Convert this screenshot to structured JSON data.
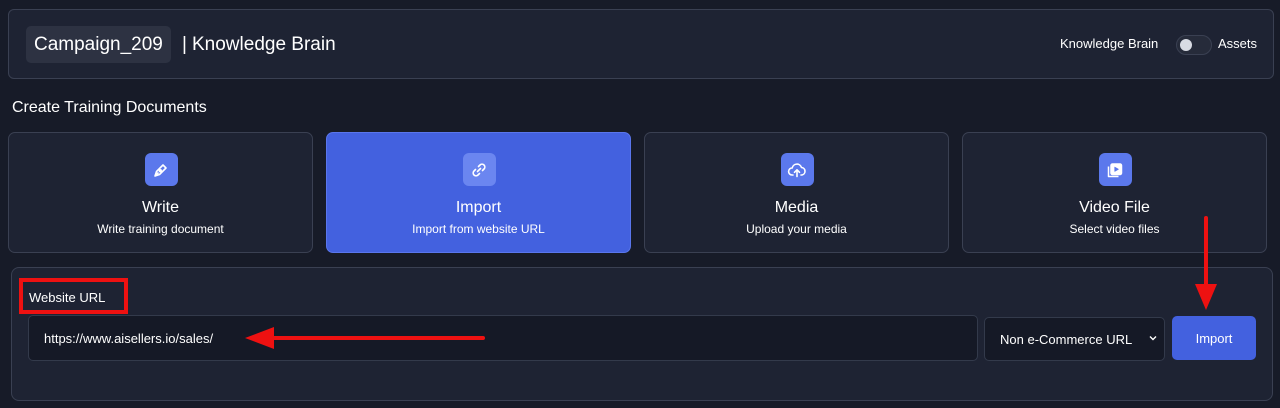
{
  "header": {
    "campaign": "Campaign_209",
    "separator": "|",
    "title": "Knowledge Brain",
    "toggle_left_label": "Knowledge Brain",
    "toggle_right_label": "Assets",
    "toggle_on": false
  },
  "section_title": "Create Training Documents",
  "cards": [
    {
      "title": "Write",
      "subtitle": "Write training document",
      "icon": "pen-icon",
      "active": false
    },
    {
      "title": "Import",
      "subtitle": "Import from website URL",
      "icon": "link-icon",
      "active": true
    },
    {
      "title": "Media",
      "subtitle": "Upload your media",
      "icon": "cloud-upload-icon",
      "active": false
    },
    {
      "title": "Video File",
      "subtitle": "Select video files",
      "icon": "video-file-icon",
      "active": false
    }
  ],
  "url_form": {
    "label": "Website URL",
    "value": "https://www.aisellers.io/sales/",
    "select_value": "Non e-Commerce URL",
    "import_label": "Import"
  },
  "colors": {
    "background": "#171b28",
    "panel": "#1e2333",
    "accent": "#4361df",
    "annotation": "#ee1111"
  }
}
